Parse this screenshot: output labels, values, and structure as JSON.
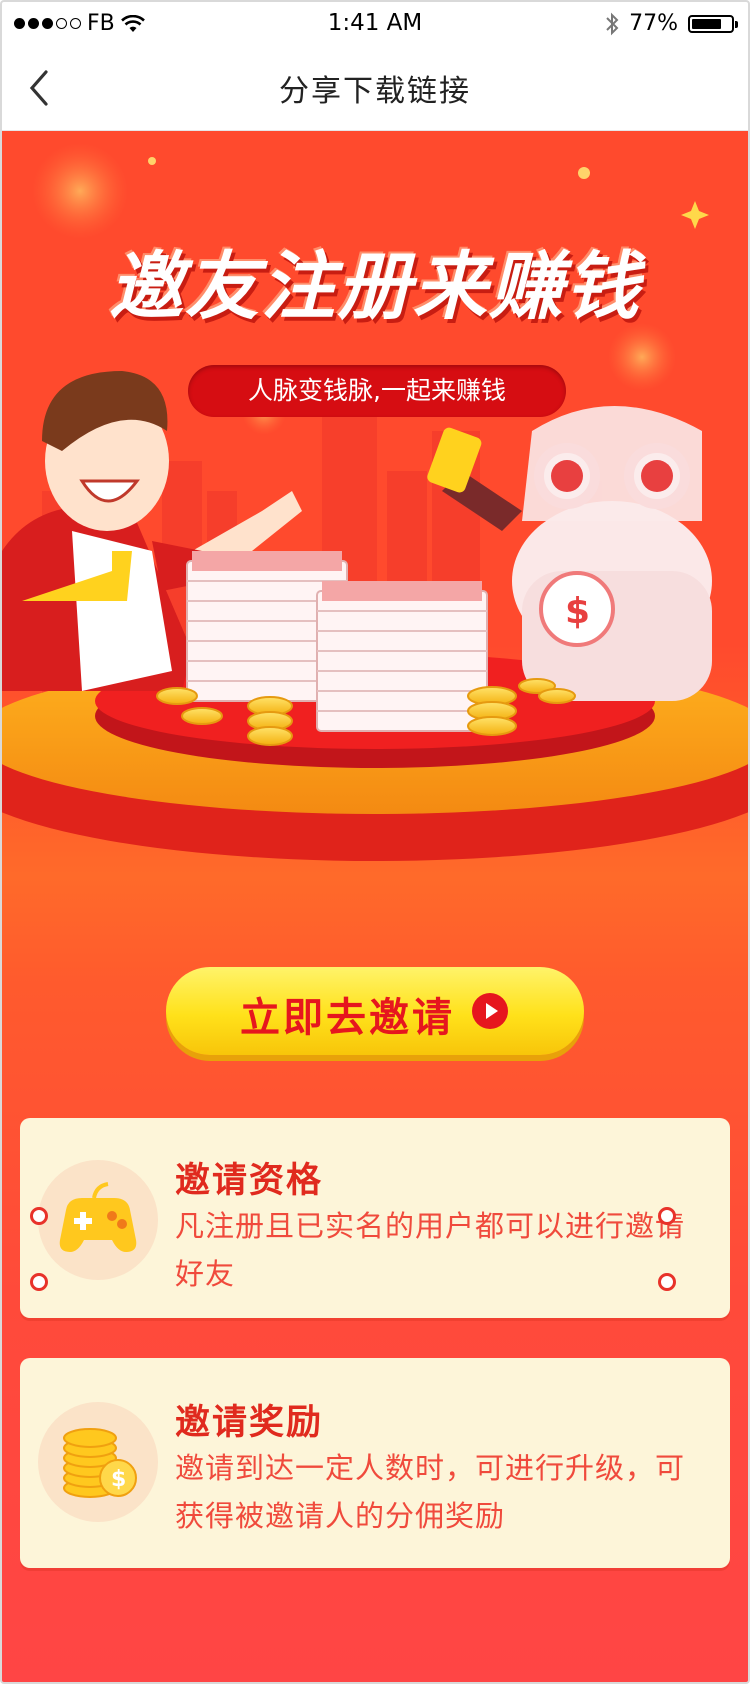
{
  "status_bar": {
    "carrier": "FB",
    "time": "1:41 AM",
    "battery_percent": "77%",
    "battery_level": 0.77,
    "signal_icon": "signal-dots-icon",
    "wifi_icon": "wifi-icon",
    "bluetooth_icon": "bluetooth-icon"
  },
  "nav": {
    "title": "分享下载链接",
    "back_icon": "chevron-left-icon"
  },
  "hero": {
    "title": "邀友注册来赚钱",
    "subtitle": "人脉变钱脉,一起来赚钱",
    "illustration": "man-robot-money-stage-illustration"
  },
  "cta": {
    "label": "立即去邀请",
    "icon": "play-circle-icon"
  },
  "cards": [
    {
      "title": "邀请资格",
      "text": "凡注册且已实名的用户都可以进行邀请好友",
      "icon": "gamepad-icon"
    },
    {
      "title": "邀请奖励",
      "text": "邀请到达一定人数时，可进行升级，可获得被邀请人的分佣奖励",
      "icon": "gold-coins-icon"
    }
  ],
  "colors": {
    "primary_red": "#ff4a2d",
    "dark_red": "#d60d12",
    "button_yellow": "#ffe11a",
    "card_bg": "#fdf5d9",
    "card_title": "#e02a1e",
    "card_text": "#f04a3c"
  }
}
